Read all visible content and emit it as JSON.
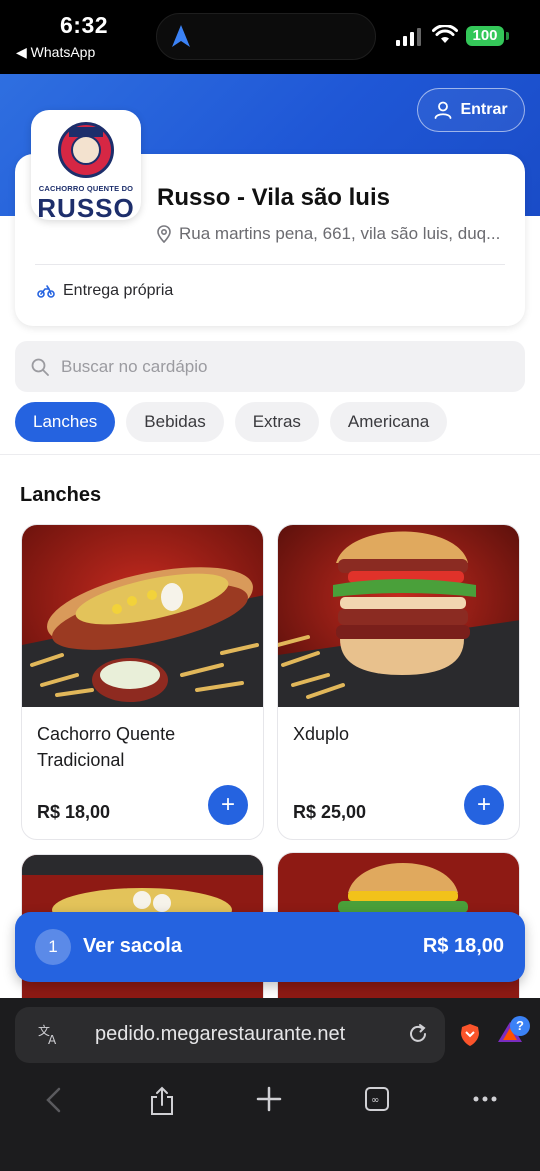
{
  "status_bar": {
    "time": "6:32",
    "back_app": "◀ WhatsApp",
    "battery": "100"
  },
  "header": {
    "login_label": "Entrar"
  },
  "store": {
    "logo_text_small": "CACHORRO QUENTE DO",
    "logo_text_big": "RUSSO",
    "name": "Russo - Vila são luis",
    "address": "Rua martins pena, 661, vila são luis, duq...",
    "delivery": "Entrega própria"
  },
  "search": {
    "placeholder": "Buscar no cardápio"
  },
  "categories": [
    {
      "label": "Lanches",
      "active": true
    },
    {
      "label": "Bebidas",
      "active": false
    },
    {
      "label": "Extras",
      "active": false
    },
    {
      "label": "Americana",
      "active": false
    }
  ],
  "section": {
    "title": "Lanches"
  },
  "products": [
    {
      "name": "Cachorro Quente Tradicional",
      "price": "R$ 18,00"
    },
    {
      "name": "Xduplo",
      "price": "R$ 25,00"
    }
  ],
  "bag": {
    "count": "1",
    "label": "Ver sacola",
    "total": "R$ 18,00"
  },
  "browser": {
    "url": "pedido.megarestaurante.net",
    "badge": "?"
  },
  "colors": {
    "accent": "#2563e0",
    "hero": "#1f57d6",
    "battery": "#34c759"
  }
}
